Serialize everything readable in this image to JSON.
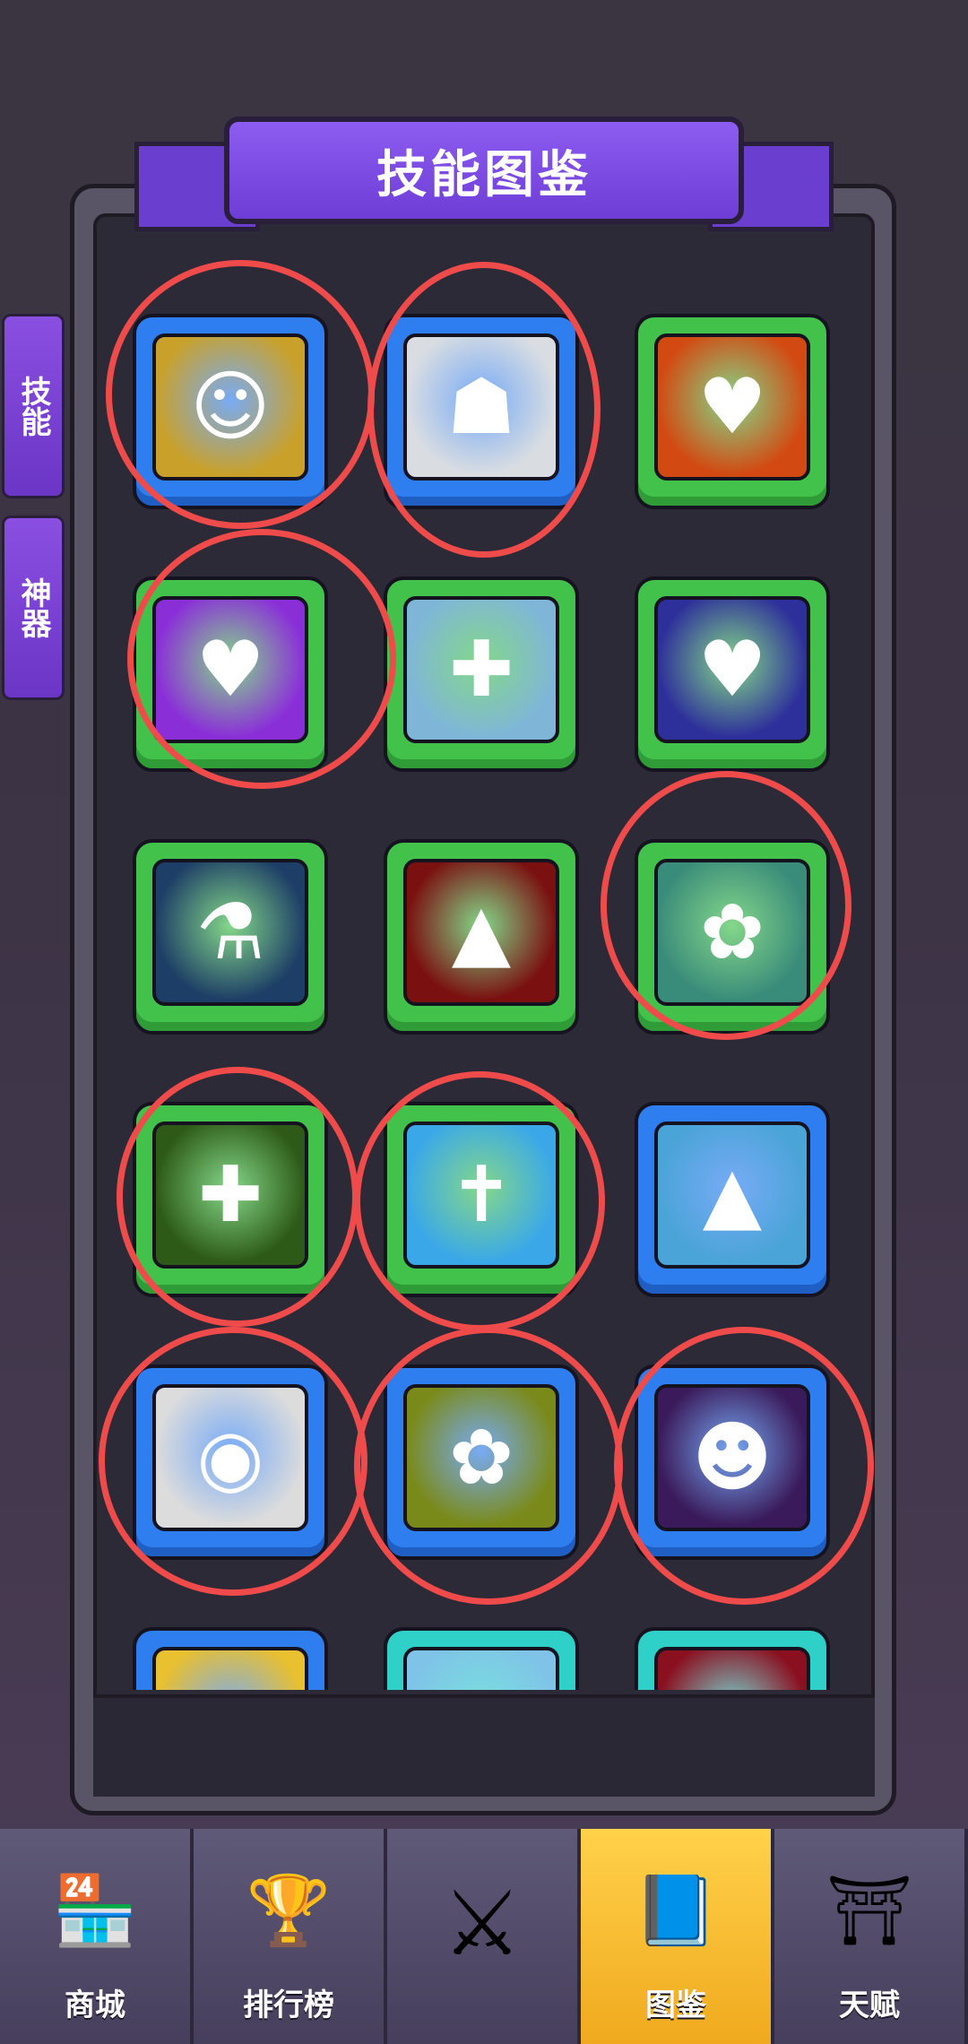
{
  "header": {
    "title": "技能图鉴"
  },
  "side_tabs": [
    {
      "label": "技能"
    },
    {
      "label": "神器"
    }
  ],
  "skills": [
    {
      "name": "yellow-figure-icon",
      "frame": "blue",
      "glyph": "☺",
      "bg": "#c9a12a"
    },
    {
      "name": "nun-icon",
      "frame": "blue",
      "glyph": "☗",
      "bg": "#d9dde2"
    },
    {
      "name": "glowing-heart-body-icon",
      "frame": "green",
      "glyph": "♥",
      "bg": "#d24a12"
    },
    {
      "name": "heart-in-hand-icon",
      "frame": "green",
      "glyph": "♥",
      "bg": "#8a2fd8"
    },
    {
      "name": "holy-cross-icon",
      "frame": "green",
      "glyph": "✚",
      "bg": "#7fb6d8"
    },
    {
      "name": "dark-heart-icon",
      "frame": "green",
      "glyph": "♥",
      "bg": "#2d2f9a"
    },
    {
      "name": "potion-icon",
      "frame": "green",
      "glyph": "⚗",
      "bg": "#1d3e66"
    },
    {
      "name": "blood-fang-icon",
      "frame": "green",
      "glyph": "▲",
      "bg": "#7a1010"
    },
    {
      "name": "green-plant-icon",
      "frame": "green",
      "glyph": "✿",
      "bg": "#3a8c7a"
    },
    {
      "name": "healing-figure-icon",
      "frame": "green",
      "glyph": "✚",
      "bg": "#2d5a16"
    },
    {
      "name": "white-cross-icon",
      "frame": "green",
      "glyph": "✝",
      "bg": "#3aa8e8"
    },
    {
      "name": "lightning-fang-icon",
      "frame": "blue",
      "glyph": "▲",
      "bg": "#4aa4d8"
    },
    {
      "name": "vortex-icon",
      "frame": "blue",
      "glyph": "◉",
      "bg": "#dcdcdc"
    },
    {
      "name": "rafflesia-icon",
      "frame": "blue",
      "glyph": "✿",
      "bg": "#7a8a1a"
    },
    {
      "name": "shadow-figure-icon",
      "frame": "blue",
      "glyph": "☻",
      "bg": "#3a1a5a"
    },
    {
      "name": "dice-icon",
      "frame": "blue",
      "glyph": "⚄",
      "bg": "#e8c030"
    },
    {
      "name": "ice-crystal-icon",
      "frame": "teal",
      "glyph": "❄",
      "bg": "#7fc4e8"
    },
    {
      "name": "red-orb-icon",
      "frame": "teal",
      "glyph": "●",
      "bg": "#8a1020"
    }
  ],
  "nav": [
    {
      "label": "商城",
      "icon": "shop-icon",
      "glyph": "🏪"
    },
    {
      "label": "排行榜",
      "icon": "trophy-icon",
      "glyph": "🏆"
    },
    {
      "label": "",
      "icon": "crossed-swords-icon",
      "glyph": "⚔"
    },
    {
      "label": "图鉴",
      "icon": "book-icon",
      "glyph": "📘"
    },
    {
      "label": "天赋",
      "icon": "gate-icon",
      "glyph": "⛩"
    }
  ],
  "active_nav_index": 3,
  "colors": {
    "annotation": "#ef4b4b",
    "accent": "#7a46dc"
  }
}
